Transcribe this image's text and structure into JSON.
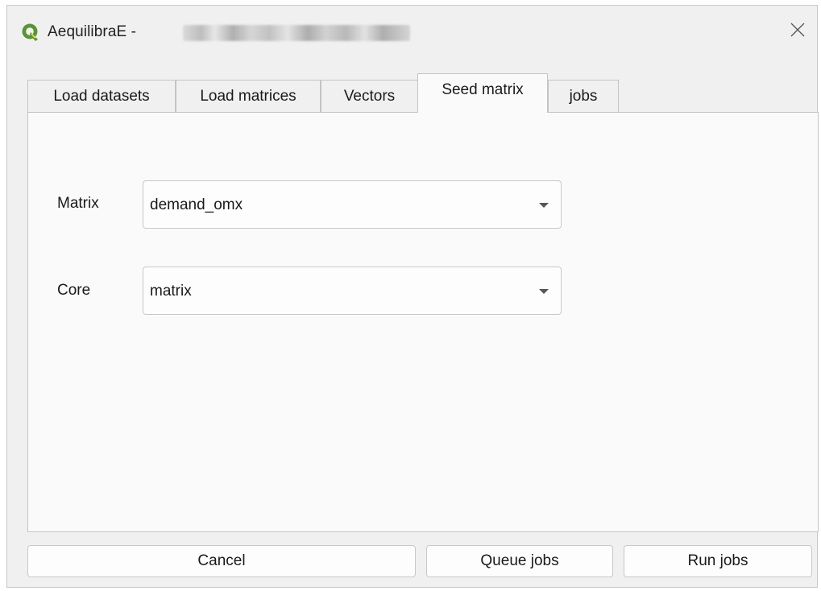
{
  "window": {
    "title": "AequilibraE -",
    "title_suffix_redacted": true
  },
  "tabs": [
    {
      "label": "Load datasets",
      "active": false
    },
    {
      "label": "Load matrices",
      "active": false
    },
    {
      "label": "Vectors",
      "active": false
    },
    {
      "label": "Seed matrix",
      "active": true
    },
    {
      "label": "jobs",
      "active": false
    }
  ],
  "seed_matrix": {
    "matrix_label": "Matrix",
    "matrix_value": "demand_omx",
    "core_label": "Core",
    "core_value": "matrix"
  },
  "buttons": {
    "cancel": "Cancel",
    "queue_jobs": "Queue jobs",
    "run_jobs": "Run jobs"
  },
  "icons": {
    "app": "qgis-logo-icon",
    "close": "close-icon",
    "dropdown": "chevron-down-icon"
  },
  "colors": {
    "qgis_green": "#589632",
    "qgis_yellow": "#f0e64a"
  }
}
